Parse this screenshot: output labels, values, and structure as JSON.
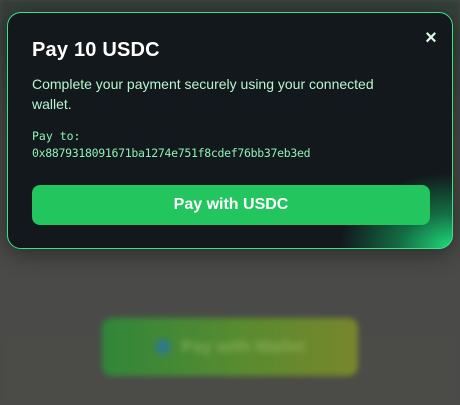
{
  "modal": {
    "title": "Pay 10 USDC",
    "description": "Complete your payment securely using your connected wallet.",
    "pay_to_label": "Pay to:",
    "pay_to_address": "0x8879318091671ba1274e751f8cdef76bb37eb3ed",
    "pay_button_label": "Pay with USDC",
    "close_icon": "×"
  },
  "background": {
    "button_label": "Pay with Wallet"
  },
  "colors": {
    "accent": "#22c55e",
    "modal_border": "#3ee08a",
    "modal_bg": "#12181c",
    "text_mint": "#b9f5cf"
  }
}
